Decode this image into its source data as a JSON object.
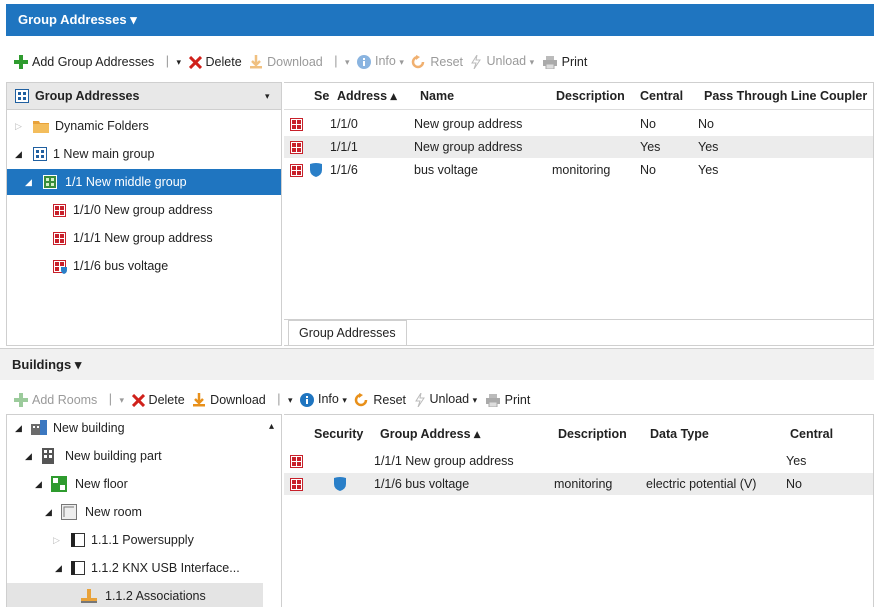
{
  "top": {
    "title": "Group Addresses ▾",
    "toolbar": {
      "add": "Add Group Addresses",
      "delete": "Delete",
      "download": "Download",
      "info": "Info",
      "reset": "Reset",
      "unload": "Unload",
      "print": "Print"
    },
    "tree": {
      "header": "Group Addresses",
      "items": [
        {
          "label": "Dynamic Folders"
        },
        {
          "label": "1 New main group"
        },
        {
          "label": "1/1 New middle group"
        },
        {
          "label": "1/1/0 New group address"
        },
        {
          "label": "1/1/1 New group address"
        },
        {
          "label": "1/1/6 bus voltage"
        }
      ]
    },
    "grid": {
      "headers": [
        "Se",
        "Address ▴",
        "Name",
        "Description",
        "Central",
        "Pass Through Line Coupler"
      ],
      "rows": [
        {
          "address": "1/1/0",
          "name": "New group address",
          "description": "",
          "central": "No",
          "pass": "No"
        },
        {
          "address": "1/1/1",
          "name": "New group address",
          "description": "",
          "central": "Yes",
          "pass": "Yes"
        },
        {
          "address": "1/1/6",
          "name": "bus voltage",
          "description": "monitoring",
          "central": "No",
          "pass": "Yes"
        }
      ]
    },
    "tab": "Group Addresses"
  },
  "bottom": {
    "title": "Buildings ▾",
    "toolbar": {
      "add": "Add Rooms",
      "delete": "Delete",
      "download": "Download",
      "info": "Info",
      "reset": "Reset",
      "unload": "Unload",
      "print": "Print"
    },
    "tree": {
      "items": [
        {
          "label": "New building"
        },
        {
          "label": "New building part"
        },
        {
          "label": "New floor"
        },
        {
          "label": "New room"
        },
        {
          "label": "1.1.1 Powersupply"
        },
        {
          "label": "1.1.2 KNX USB Interface..."
        },
        {
          "label": "1.1.2 Associations"
        }
      ]
    },
    "grid": {
      "headers": [
        "Security",
        "Group Address ▴",
        "Description",
        "Data Type",
        "Central"
      ],
      "rows": [
        {
          "group": "1/1/1 New group address",
          "description": "",
          "datatype": "",
          "central": "Yes"
        },
        {
          "group": "1/1/6 bus voltage",
          "description": "monitoring",
          "datatype": "electric potential (V)",
          "central": "No"
        }
      ]
    }
  },
  "colors": {
    "accent": "#1f75c0",
    "ga_red": "#c8202a",
    "green": "#2e9b2e",
    "shield": "#2a7fc8",
    "alt_row": "#ececec"
  },
  "icons": [
    "plus-icon",
    "delete-x-icon",
    "download-icon",
    "info-icon",
    "reset-icon",
    "unload-icon",
    "print-icon",
    "folder-icon",
    "group-icon",
    "group-address-icon",
    "shield-icon",
    "building-icon",
    "floor-icon",
    "room-icon",
    "device-icon",
    "association-icon"
  ]
}
